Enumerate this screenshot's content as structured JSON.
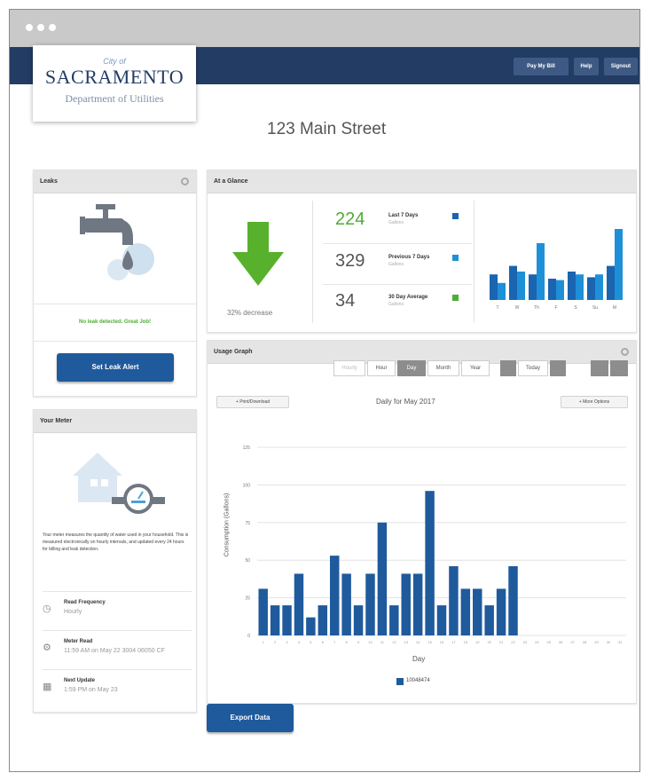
{
  "nav": {
    "pay_bill": "Pay My Bill",
    "help": "Help",
    "signout": "Signout"
  },
  "logo": {
    "city": "City of",
    "name": "SACRAMENTO",
    "dept": "Department of Utilities"
  },
  "address": "123 Main Street",
  "leaks": {
    "title": "Leaks",
    "status": "No leak detected. Great Job!",
    "button": "Set Leak Alert"
  },
  "meter": {
    "title": "Your Meter",
    "description": "Your meter measures the quantity of water used in your household. This is measured electronically on hourly intervals, and updated every 24 hours for billing and leak detection.",
    "rows": [
      {
        "icon": "clock-icon",
        "label": "Read Frequency",
        "value": "Hourly"
      },
      {
        "icon": "meter-icon",
        "label": "Meter Read",
        "value": "11:59 AM on May 22 3004 06050 CF"
      },
      {
        "icon": "calendar-icon",
        "label": "Next Update",
        "value": "1:59 PM on May 23"
      }
    ]
  },
  "glance": {
    "title": "At a Glance",
    "decrease": "32% decrease",
    "stats": [
      {
        "number": "224",
        "label": "Last 7 Days",
        "unit": "Gallons",
        "color": "#1a64b0",
        "numcolor": "#4cae32"
      },
      {
        "number": "329",
        "label": "Previous 7 Days",
        "unit": "Gallons",
        "color": "#1e90d8",
        "numcolor": "#555555"
      },
      {
        "number": "34",
        "label": "30 Day Average",
        "unit": "Gallons",
        "color": "#4cae32",
        "numcolor": "#555555"
      }
    ],
    "mini_chart": {
      "categories": [
        "T",
        "W",
        "Th",
        "F",
        "S",
        "Su",
        "M"
      ],
      "current": [
        18,
        24,
        18,
        15,
        20,
        16,
        24
      ],
      "previous": [
        12,
        20,
        40,
        14,
        18,
        18,
        50
      ]
    }
  },
  "usage": {
    "title": "Usage Graph",
    "tabs": [
      "Hourly",
      "Hour",
      "Day",
      "Month",
      "Year"
    ],
    "active_tab": "Day",
    "today": "Today",
    "print": "+ Print/Download",
    "more": "+ More Options",
    "export": "Export Data"
  },
  "chart_data": {
    "type": "bar",
    "title": "Daily for May 2017",
    "xlabel": "Day",
    "ylabel": "Consumption (Gallons)",
    "ylim": [
      0,
      125
    ],
    "yticks": [
      0,
      25,
      50,
      75,
      100,
      125
    ],
    "x": [
      "1",
      "2",
      "3",
      "4",
      "5",
      "6",
      "7",
      "8",
      "9",
      "10",
      "11",
      "12",
      "13",
      "14",
      "15",
      "16",
      "17",
      "18",
      "19",
      "20",
      "21",
      "22",
      "23",
      "24",
      "25",
      "26",
      "27",
      "28",
      "29",
      "30",
      "31"
    ],
    "series": [
      {
        "name": "10048474",
        "values": [
          31,
          20,
          20,
          41,
          12,
          20,
          53,
          41,
          20,
          41,
          75,
          20,
          41,
          41,
          96,
          20,
          46,
          31,
          31,
          20,
          31,
          46,
          0,
          0,
          0,
          0,
          0,
          0,
          0,
          0,
          0
        ]
      }
    ],
    "legend": "bottom",
    "grid": true,
    "color": "#1f5a9c"
  }
}
